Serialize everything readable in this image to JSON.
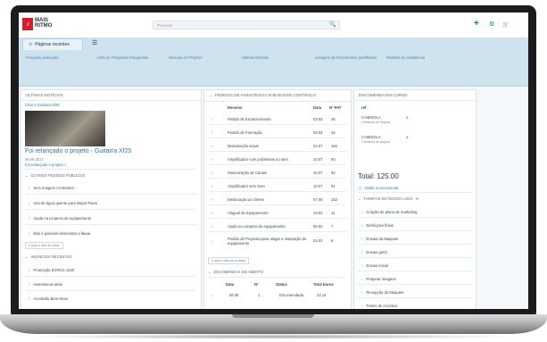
{
  "header": {
    "logo_mark": "♪",
    "logo_text": "MAIS RITMO",
    "search_placeholder": "Procurar",
    "plus_icon": "plus-icon",
    "settings_icon": "gear-icon",
    "cart_icon": "cart-icon"
  },
  "tabs": {
    "recent_label": "Páginas recentes"
  },
  "quicklinks": [
    "Pesquisa avançada",
    "Lista de Perguntas Frequentes",
    "Notícias de Projetos",
    "Últimas Notícias",
    "Listagem de Documentos partilhados",
    "Pedidos de Assistência"
  ],
  "news": {
    "title": "ÚLTIMAS NOTÍCIAS",
    "breadcrumb": "Criar a Guitarra Xf25",
    "headline": "Foi relançado o projeto - Guitarra Xf25",
    "date": "08.06.2017",
    "subtitle": "Foi relançado o projeto »"
  },
  "public_requests": {
    "title": "ÚLTIMOS PEDIDOS PÚBLICOS",
    "items": [
      "Sem imagem no Monitor",
      "Uso de água quente para limpar Piano",
      "Ajuda na Limpeza do equipamento",
      "Não é possível desmontar a flauta"
    ],
    "more": "Ir para a lista de todos"
  },
  "announcements": {
    "title": "ANÚNCIOS RECENTES",
    "items": [
      "Promoção ECRCG 1420",
      "Harmónicas úteis",
      "Acordeão Bem-Novo"
    ]
  },
  "assistance": {
    "title": "PEDIDOS DE ASSISTÊNCIA SOB NOSSO CONTROLO",
    "headers": [
      "Resumo",
      "Data",
      "Nº PAT"
    ],
    "rows": [
      [
        "Pedido de Esclarecimento",
        "03.03",
        "45"
      ],
      [
        "Pedido de Formação",
        "03.03",
        "44"
      ],
      [
        "Manutenção anual",
        "24.07",
        "164"
      ],
      [
        "Amplificador com problemas no som",
        "10.07",
        "93"
      ],
      [
        "Sintonização de Canais",
        "10.07",
        "92"
      ],
      [
        "Amplificador sem Som",
        "10.07",
        "91"
      ],
      [
        "Deslocação ao cliente",
        "07.06",
        "152"
      ],
      [
        "Aluguel de Equipamento",
        "13.02",
        "11"
      ],
      [
        "Ajuda na Limpeza do equipamento",
        "06.02",
        "7"
      ],
      [
        "Pedido de Proposta para alugar e instalação de equipamento",
        "02.02",
        "6"
      ]
    ],
    "more": "Ir para a lista de pedidos"
  },
  "orders_open": {
    "title": "ENCOMENDAS EM ABERTO",
    "headers": [
      "Data",
      "Nº",
      "Status",
      "Total Euros"
    ],
    "rows": [
      [
        "06.06",
        "1",
        "Encomendada",
        "23.14"
      ]
    ]
  },
  "order_progress": {
    "title": "ENCOMENDA EM CURSO",
    "ref_label": "ref",
    "items": [
      {
        "name": "CAMISOLA",
        "qty": "1",
        "desc": "Camisola de angorá"
      },
      {
        "name": "CAMISOLA",
        "qty": "1",
        "desc": "Camisola de angorá"
      }
    ],
    "total": "Total: 125.00",
    "view_link": "Visitar a encomenda"
  },
  "tasks": {
    "title": "TAREFAS DO NOSSO LADO",
    "items": [
      "Criação de plano de marketing",
      "Definições finais",
      "Ensaio da Maquete",
      "Ensaio geral",
      "Ensaio inicial",
      "Preparar imagens",
      "Recepção da Maquete",
      "Testes de Acústica"
    ]
  }
}
